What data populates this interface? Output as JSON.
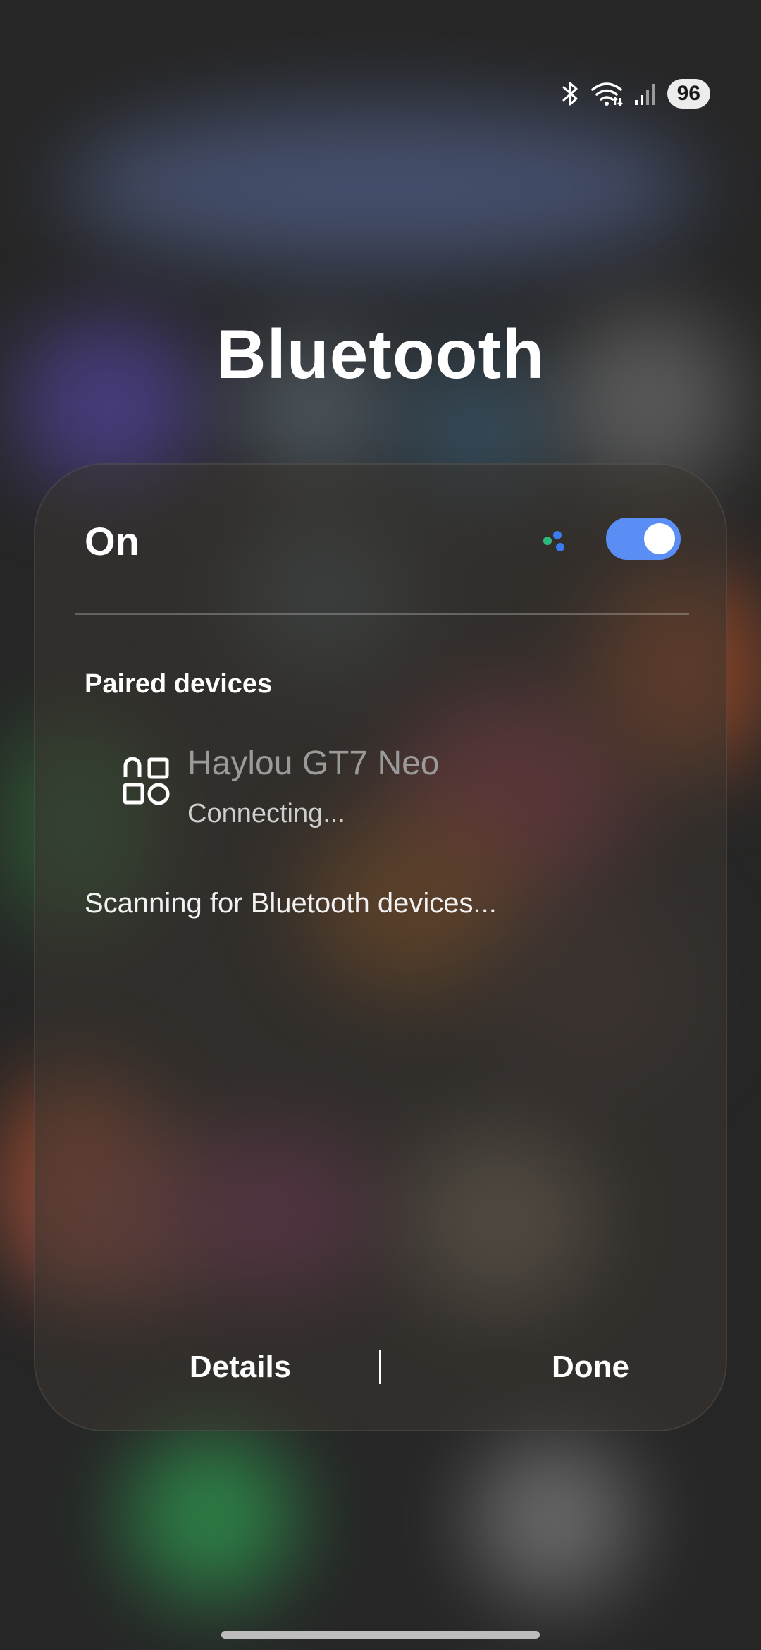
{
  "status_bar": {
    "battery_level": "96",
    "icons": [
      "bluetooth-icon",
      "wifi-icon",
      "signal-icon"
    ]
  },
  "title": "Bluetooth",
  "toggle": {
    "label": "On",
    "state": "on",
    "accent_color": "#5b8ef5"
  },
  "paired": {
    "header": "Paired devices",
    "devices": [
      {
        "name": "Haylou GT7 Neo",
        "status": "Connecting...",
        "icon": "apps-icon"
      }
    ]
  },
  "scanning_text": "Scanning for Bluetooth devices...",
  "footer": {
    "details_label": "Details",
    "done_label": "Done"
  }
}
